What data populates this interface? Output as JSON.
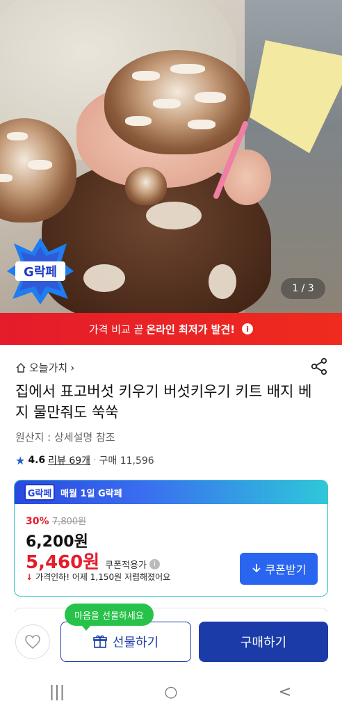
{
  "hero": {
    "badge_text": "G락페",
    "pager": "1 / 3"
  },
  "promo": {
    "prefix": "가격 비교 끝",
    "highlight": "온라인 최저가 발견!",
    "info_icon": "i"
  },
  "breadcrumb": {
    "label": "오늘가치",
    "chevron": "›"
  },
  "product": {
    "title": "집에서 표고버섯 키우기 버섯키우기 키트 배지 베지 물만줘도 쑥쑥",
    "origin": "원산지 : 상세설명 참조",
    "rating": "4.6",
    "reviews": "리뷰 69개",
    "purchases": "구매 11,596"
  },
  "price_box": {
    "header_logo": "G락페",
    "header_text": "매월 1일 G락페",
    "discount_pct": "30%",
    "original_price": "7,800원",
    "sale_price": "6,200원",
    "coupon_price": "5,460원",
    "coupon_label": "쿠폰적용가",
    "drop_notice": "가격인하! 어제 1,150원 저렴해졌어요",
    "coupon_button": "쿠폰받기"
  },
  "bottom": {
    "tooltip": "마음을 선물하세요",
    "gift_button": "선물하기",
    "buy_button": "구매하기"
  },
  "system_nav": {
    "recents": "|||",
    "home": "○",
    "back": "<"
  },
  "colors": {
    "accent": "#1b3ba8",
    "promo": "#e41c2b",
    "coupon_btn": "#2a65f0",
    "tooltip": "#26c24a"
  }
}
